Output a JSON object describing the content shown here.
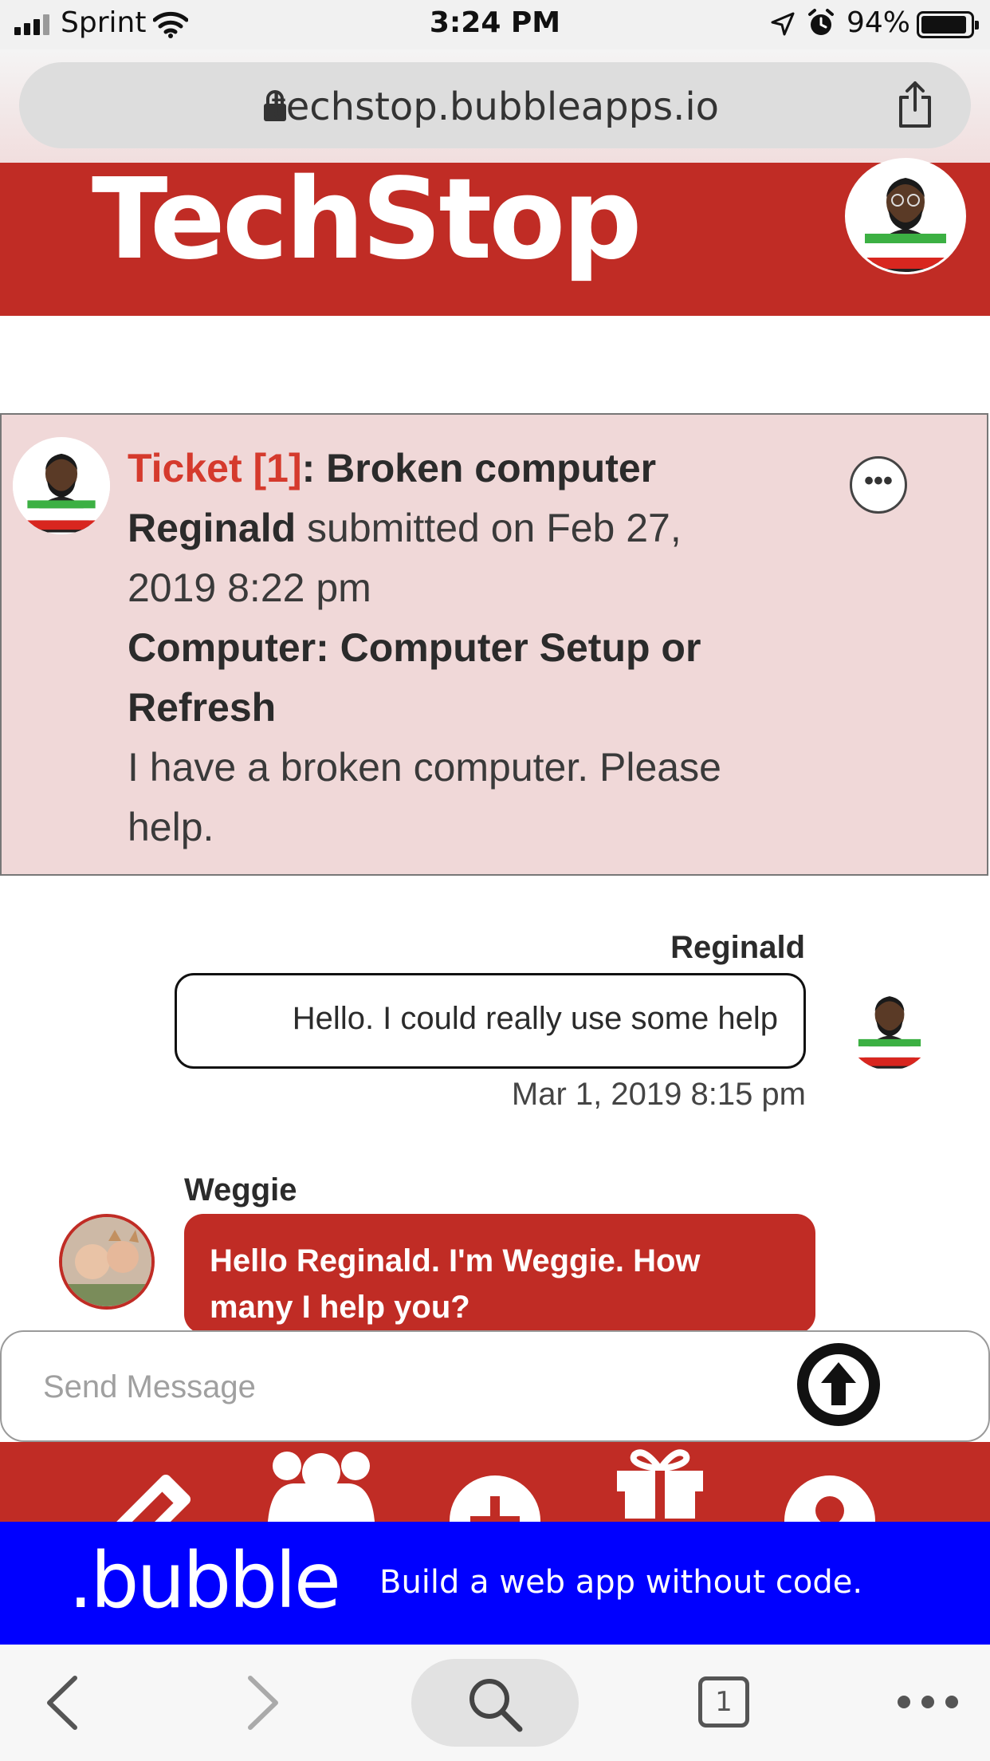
{
  "status_bar": {
    "carrier": "Sprint",
    "time": "3:24 PM",
    "battery": "94%",
    "battery_level": 0.94
  },
  "browser": {
    "url": "techstop.bubbleapps.io",
    "tab_count": "1"
  },
  "app": {
    "title": "TechStop",
    "brand_color": "#c02c25"
  },
  "ticket": {
    "label": "Ticket [1]",
    "subject": ": Broken computer",
    "submitter": "Reginald",
    "submitted_text": " submitted on Feb 27,",
    "submitted_date_line2": "2019 8:22 pm",
    "category_line1": "Computer: Computer Setup or",
    "category_line2": "Refresh",
    "description_line1": "I have a broken computer. Please",
    "description_line2": "help."
  },
  "messages": [
    {
      "sender": "Reginald",
      "text": "Hello. I could really use some help",
      "timestamp": "Mar 1, 2019 8:15 pm"
    },
    {
      "sender": "Weggie",
      "text_line1": "Hello Reginald. I'm Weggie. How",
      "text_line2": "many I help you?"
    }
  ],
  "composer": {
    "placeholder": "Send Message"
  },
  "banner": {
    "logo": ".bubble",
    "tagline": "Build a web app without code.",
    "color": "#0000ff"
  },
  "icons": {
    "signal": "signal-bars-icon",
    "wifi": "wifi-icon",
    "location": "location-arrow-icon",
    "alarm": "alarm-clock-icon",
    "battery": "battery-icon",
    "lock": "lock-icon",
    "share": "share-icon",
    "more": "more-horizontal-icon",
    "send": "arrow-up-circle-icon",
    "nav": [
      "ticket-icon",
      "users-icon",
      "add-icon",
      "gift-icon",
      "profile-icon"
    ],
    "browser": [
      "back-icon",
      "forward-icon",
      "search-icon",
      "tabs-icon",
      "menu-dots-icon"
    ]
  }
}
